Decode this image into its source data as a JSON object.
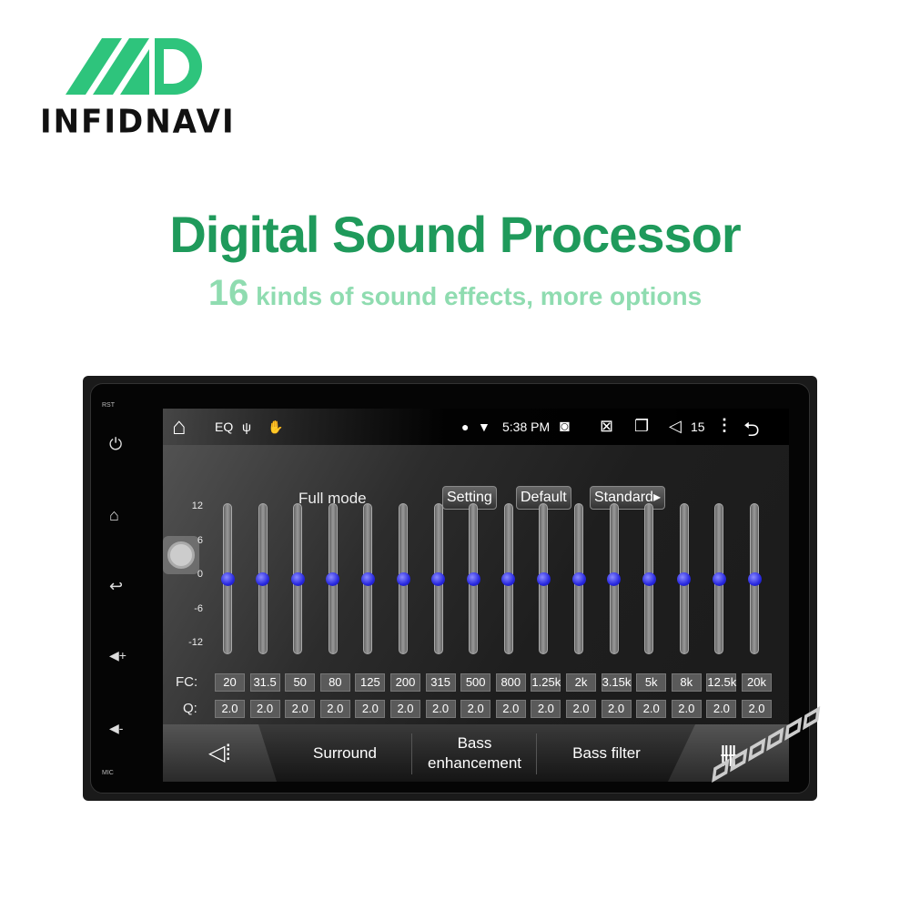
{
  "logo": {
    "mark": "MD",
    "brand": "INFIDNAVI",
    "color": "#2ec47c"
  },
  "headline": {
    "title": "Digital Sound Processor",
    "subtitle_num": "16",
    "subtitle_rest": " kinds of sound effects, more options",
    "title_color": "#1f9a5b",
    "subtitle_color": "#8fdcb0"
  },
  "device": {
    "side": {
      "rst": "RST",
      "mic": "MIC",
      "icons": [
        "power-icon",
        "home-icon",
        "back-icon",
        "volume-up-icon",
        "volume-down-icon"
      ]
    },
    "status": {
      "app": "EQ",
      "time": "5:38 PM",
      "volume": "15"
    },
    "mode": {
      "label": "Full mode",
      "buttons": [
        "Setting",
        "Default",
        "Standard▸"
      ]
    },
    "scale": [
      "12",
      "6",
      "0",
      "-6",
      "-12"
    ],
    "eq": {
      "range_db": [
        -12,
        12
      ],
      "levels_db": [
        0,
        0,
        0,
        0,
        0,
        0,
        0,
        0,
        0,
        0,
        0,
        0,
        0,
        0,
        0,
        0
      ],
      "knob_color": "#2828e0"
    },
    "fc_label": "FC:",
    "q_label": "Q:",
    "fc": [
      "20",
      "31.5",
      "50",
      "80",
      "125",
      "200",
      "315",
      "500",
      "800",
      "1.25k",
      "2k",
      "3.15k",
      "5k",
      "8k",
      "12.5k",
      "20k"
    ],
    "q": [
      "2.0",
      "2.0",
      "2.0",
      "2.0",
      "2.0",
      "2.0",
      "2.0",
      "2.0",
      "2.0",
      "2.0",
      "2.0",
      "2.0",
      "2.0",
      "2.0",
      "2.0",
      "2.0"
    ],
    "tabs": {
      "surround": "Surround",
      "bass": "Bass enhancement",
      "bass_filter": "Bass filter"
    }
  },
  "watermark": "INFIDNAVI"
}
